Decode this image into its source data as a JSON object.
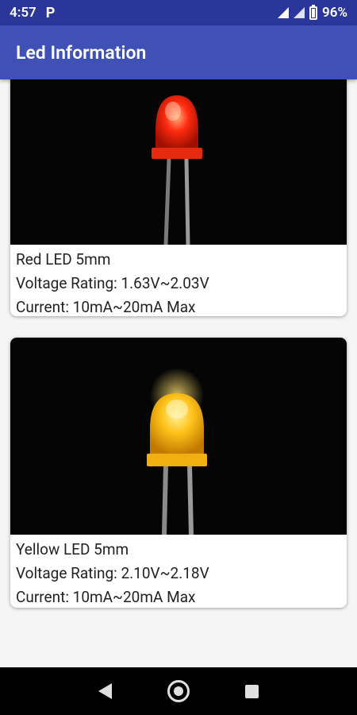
{
  "status_bar": {
    "time": "4:57",
    "notification_icon": "P",
    "battery": "96%"
  },
  "app_bar": {
    "title": "Led Information"
  },
  "leds": [
    {
      "name": "Red LED 5mm",
      "voltage": "Voltage Rating: 1.63V~2.03V",
      "current": "Current: 10mA~20mA Max",
      "color": "#ff2a10"
    },
    {
      "name": "Yellow LED 5mm",
      "voltage": "Voltage Rating: 2.10V~2.18V",
      "current": "Current: 10mA~20mA Max",
      "color": "#ffc21a"
    }
  ],
  "nav": {
    "back_icon": "back-icon",
    "home_icon": "home-icon",
    "recents_icon": "recents-icon"
  }
}
